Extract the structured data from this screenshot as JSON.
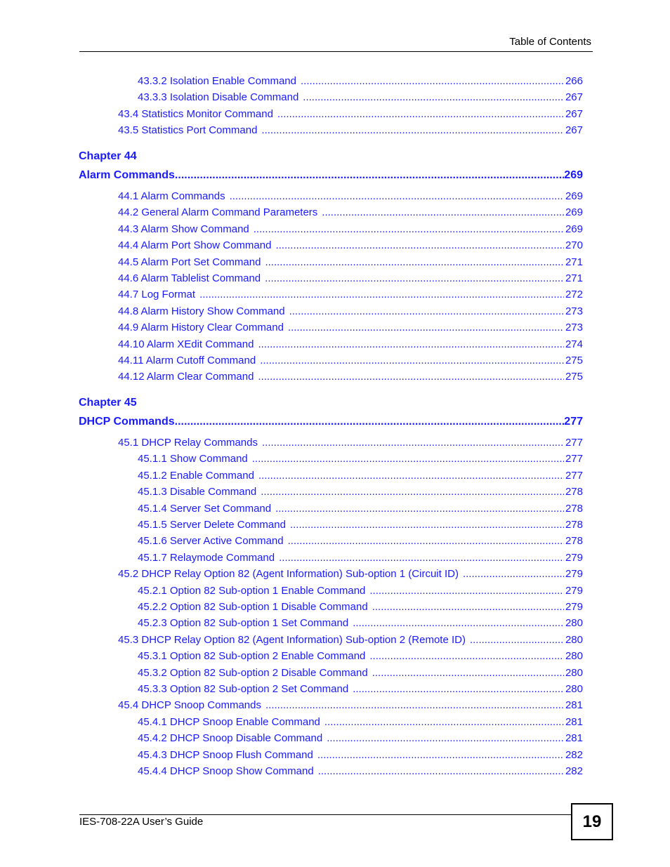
{
  "header": {
    "title": "Table of Contents"
  },
  "entries_top": [
    {
      "level": 2,
      "label": "43.3.2 Isolation Enable Command",
      "page": "266"
    },
    {
      "level": 2,
      "label": "43.3.3 Isolation Disable Command",
      "page": "267"
    },
    {
      "level": 1,
      "label": "43.4 Statistics Monitor Command",
      "page": "267"
    },
    {
      "level": 1,
      "label": "43.5 Statistics Port Command",
      "page": "267"
    }
  ],
  "chapter44": {
    "number": "Chapter  44",
    "title": "Alarm Commands",
    "page": "269",
    "entries": [
      {
        "level": 1,
        "label": "44.1 Alarm Commands",
        "page": "269"
      },
      {
        "level": 1,
        "label": "44.2 General Alarm Command Parameters",
        "page": "269"
      },
      {
        "level": 1,
        "label": "44.3 Alarm Show Command",
        "page": "269"
      },
      {
        "level": 1,
        "label": "44.4 Alarm Port Show Command",
        "page": "270"
      },
      {
        "level": 1,
        "label": "44.5 Alarm Port Set Command",
        "page": "271"
      },
      {
        "level": 1,
        "label": "44.6 Alarm Tablelist Command",
        "page": "271"
      },
      {
        "level": 1,
        "label": "44.7 Log Format",
        "page": "272"
      },
      {
        "level": 1,
        "label": "44.8 Alarm History Show Command",
        "page": "273"
      },
      {
        "level": 1,
        "label": "44.9 Alarm History Clear Command",
        "page": "273"
      },
      {
        "level": 1,
        "label": "44.10 Alarm XEdit Command",
        "page": "274"
      },
      {
        "level": 1,
        "label": "44.11 Alarm Cutoff Command",
        "page": "275"
      },
      {
        "level": 1,
        "label": "44.12 Alarm Clear Command",
        "page": "275"
      }
    ]
  },
  "chapter45": {
    "number": "Chapter  45",
    "title": "DHCP Commands",
    "page": "277",
    "entries": [
      {
        "level": 1,
        "label": "45.1 DHCP Relay Commands",
        "page": "277"
      },
      {
        "level": 2,
        "label": "45.1.1 Show Command",
        "page": "277"
      },
      {
        "level": 2,
        "label": "45.1.2 Enable Command",
        "page": "277"
      },
      {
        "level": 2,
        "label": "45.1.3 Disable Command",
        "page": "278"
      },
      {
        "level": 2,
        "label": "45.1.4 Server Set Command",
        "page": "278"
      },
      {
        "level": 2,
        "label": "45.1.5 Server Delete Command",
        "page": "278"
      },
      {
        "level": 2,
        "label": "45.1.6 Server Active Command",
        "page": "278"
      },
      {
        "level": 2,
        "label": "45.1.7 Relaymode Command",
        "page": "279"
      },
      {
        "level": 1,
        "label": "45.2 DHCP Relay Option 82 (Agent Information) Sub-option 1 (Circuit ID)",
        "page": "279"
      },
      {
        "level": 2,
        "label": "45.2.1 Option 82 Sub-option 1 Enable Command",
        "page": "279"
      },
      {
        "level": 2,
        "label": "45.2.2 Option 82 Sub-option 1 Disable Command",
        "page": "279"
      },
      {
        "level": 2,
        "label": "45.2.3 Option 82 Sub-option 1 Set Command",
        "page": "280"
      },
      {
        "level": 1,
        "label": "45.3 DHCP Relay Option 82 (Agent Information) Sub-option 2 (Remote ID)",
        "page": "280"
      },
      {
        "level": 2,
        "label": "45.3.1 Option 82 Sub-option 2 Enable Command",
        "page": "280"
      },
      {
        "level": 2,
        "label": "45.3.2 Option 82 Sub-option 2 Disable Command",
        "page": "280"
      },
      {
        "level": 2,
        "label": "45.3.3 Option 82 Sub-option 2 Set Command",
        "page": "280"
      },
      {
        "level": 1,
        "label": "45.4 DHCP Snoop Commands",
        "page": "281"
      },
      {
        "level": 2,
        "label": "45.4.1 DHCP Snoop Enable Command",
        "page": "281"
      },
      {
        "level": 2,
        "label": "45.4.2 DHCP Snoop Disable Command",
        "page": "281"
      },
      {
        "level": 2,
        "label": "45.4.3 DHCP Snoop Flush Command",
        "page": "282"
      },
      {
        "level": 2,
        "label": "45.4.4 DHCP Snoop Show Command",
        "page": "282"
      }
    ]
  },
  "footer": {
    "guide_title": "IES-708-22A User’s Guide",
    "page_number": "19"
  },
  "colors": {
    "link": "#1a1aff",
    "text": "#000000"
  }
}
